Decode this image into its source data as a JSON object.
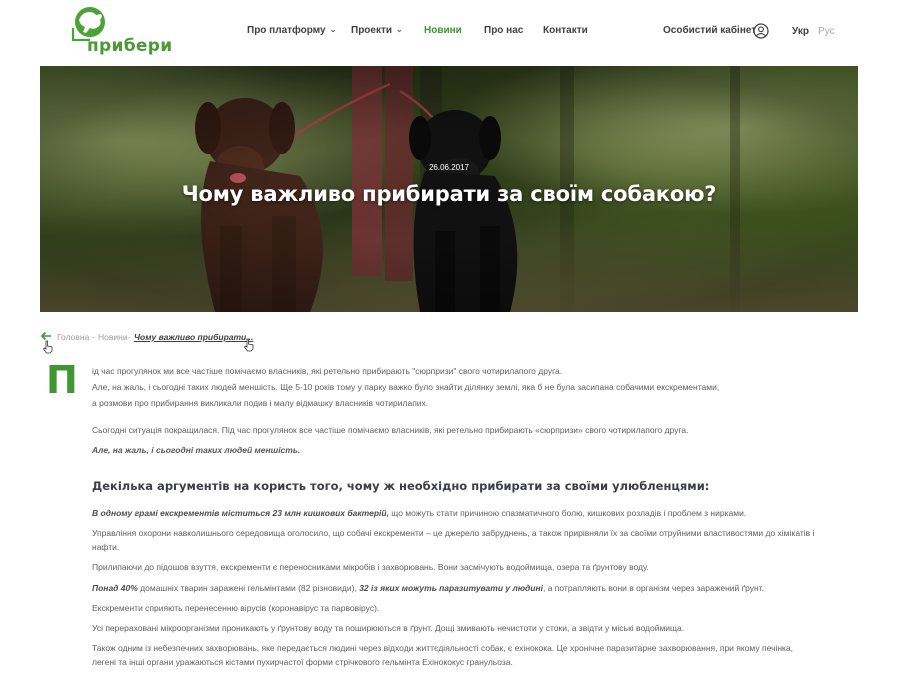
{
  "logo": {
    "text": "прибери"
  },
  "nav": [
    {
      "label": "Про платформу",
      "has_dropdown": true,
      "active": false
    },
    {
      "label": "Проекти",
      "has_dropdown": true,
      "active": false
    },
    {
      "label": "Новини",
      "has_dropdown": false,
      "active": true
    },
    {
      "label": "Про нас",
      "has_dropdown": false,
      "active": false
    },
    {
      "label": "Контакти",
      "has_dropdown": false,
      "active": false
    }
  ],
  "header": {
    "cabinet": "Особистий кабінет",
    "lang_ua": "Укр",
    "lang_ru": "Рус"
  },
  "hero": {
    "date": "26.06.2017",
    "title": "Чому важливо прибирати за своїм собакою?"
  },
  "breadcrumb": {
    "home": "Головна",
    "news": "Новини",
    "current": "Чому важливо прибирати...",
    "separator": "-"
  },
  "article": {
    "dropcap": "П",
    "intro_line1": "ід час прогулянок ми все частіше помічаємо власників, які ретельно прибирають \"сюрпризи\" свого чотирилапого друга.",
    "intro_line2": "Але, на    жаль, і сьогодні таких людей меншість. Ще 5-10 років тому у парку важко було знайти ділянку землі, яка б не була засипана собачими екскрементами,",
    "intro_line3": "а розмови про прибирання викликали подив і малу відмашку власників чотирилапих.",
    "para2": "Сьогодні ситуація покращилася. Під час прогулянок все частіше помічаємо власників,  які ретельно прибирають «сюрпризи» свого чотирилапого друга.",
    "para3": "Але, на жаль, і сьогодні таких людей меншість.",
    "heading": "Декілька аргументів на користь того, чому ж необхідно прибирати за своїми улюбленцями:",
    "arg1_bold": "В одному грамі екскрементів міститься 23 млн кишкових бактерій,",
    "arg1_rest": " що можуть стати причиною спазматичного болю, кишкових розладів і проблем з нирками.",
    "arg2_line1": "Управління охорони навколишнього середовища оголосило, що собачі екскременти – це джерело забруднень, а також прирівняли їх за своїми отруйними властивостями до хімікатів і",
    "arg2_line2": "нафти.",
    "arg3": "Прилипаючи до підошов взуття, екскременти є переносниками мікробів і захворювань. Вони засмічують водоймища, озера та ґрунтову воду.",
    "arg4_bold1": "Понад 40%",
    "arg4_mid": " домашніх тварин заражені гельмінтами (82 різновиди), ",
    "arg4_bold2": "32 із яких можуть паразитувати у людині",
    "arg4_rest": ", а потрапляють вони в організм через заражений ґрунт.",
    "arg5": "Екскременти сприяють перенесенню вірусів (коронавірус та парвовірус).",
    "arg6": "Усі перераховані мікроорганізми проникають у ґрунтову воду та поширюються в ґрунт. Дощі змивають нечистоти у стоки, а звідти у міські водоймища.",
    "arg7_line1": "Також одним із небезпечних захворювань, яке передається людині через відходи життєдіяльності собак, є ехінокока. Це хронічне паразитарне захворювання, при якому печінка,",
    "arg7_line2": "легені та інші органи уражаються кістами пухирчастої форми стрічкового гельмінта Ехінококус гранульоза."
  },
  "colors": {
    "brand_green": "#3f9632",
    "text_dark": "#3d3f44",
    "text_body": "#5c5e63"
  }
}
